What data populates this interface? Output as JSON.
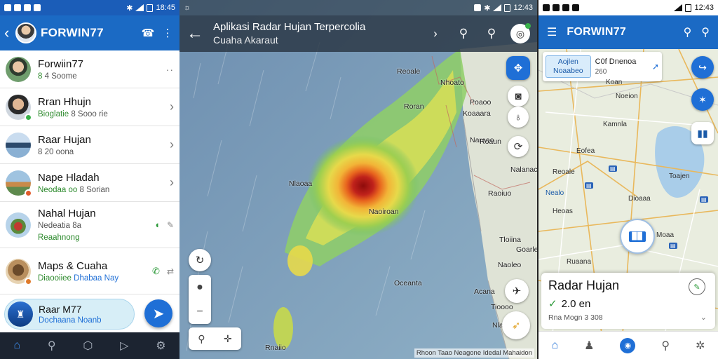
{
  "panel_messages": {
    "status": {
      "time": "18:45"
    },
    "header": {
      "title": "FORWIN77"
    },
    "rows": [
      {
        "name": "Forwiin77",
        "sub_green": "8",
        "sub": "4 Soome"
      },
      {
        "name": "Rran Hhujn",
        "sub_green": "Bioglatie",
        "sub": "8 Sooo rie"
      },
      {
        "name": "Raar Hujan",
        "sub": "8 20 oona"
      },
      {
        "name": "Nape Hladah",
        "sub_green": "Neodaa oo",
        "sub": "8 Sorian"
      },
      {
        "name": "Nahal Hujan",
        "sub": "Nedeatia 8a",
        "sub3": "Reaahnong"
      },
      {
        "name": "Maps & Cuaha",
        "sub_green": "Diaooiiee",
        "sub_blue": "Dhabaa Nay"
      }
    ],
    "player": {
      "title": "Raar M77",
      "subtitle": "Dochaana Noanb"
    }
  },
  "panel_radar": {
    "status": {
      "time": "12:43"
    },
    "header": {
      "title": "Aplikasi Radar Hujan Terpercolia",
      "subtitle": "Cuaha Akaraut"
    },
    "labels": [
      "Reoale",
      "Nhoato",
      "Roran",
      "Poaoo",
      "Nareeo",
      "Naoiroan",
      "Nlaoaa",
      "Oceanta",
      "Rnaiio",
      "Nalanacd",
      "Raoiuo",
      "Goarle",
      "Tioooo",
      "Tloiina",
      "Naoleo",
      "Acana",
      "Nlarone",
      "Roaun",
      "Koaaara"
    ],
    "attribution": "Rhoon Taao Neagone Idedal Mahaidon"
  },
  "panel_map": {
    "status": {
      "time": "12:43"
    },
    "header": {
      "title": "FORWIN77"
    },
    "card": {
      "badge_line1": "Aojlen",
      "badge_line2": "Noaabeo",
      "title": "C0f Dnenoa",
      "value": "260"
    },
    "labels": [
      "Kamnla",
      "Noeion",
      "Eofea",
      "Reoale",
      "Toajen",
      "Dioaaa",
      "Nealo",
      "Heoas",
      "Moaa",
      "Ruaana",
      "Koan"
    ],
    "sheet": {
      "title": "Radar Hujan",
      "value": "2.0 en",
      "meta": "Rna Mogn 3 308"
    }
  },
  "colors": {
    "primary": "#1b6ac4",
    "accent": "#1f6fd6",
    "positive": "#2d8a2d",
    "radar_core": "#9e0f0f"
  }
}
